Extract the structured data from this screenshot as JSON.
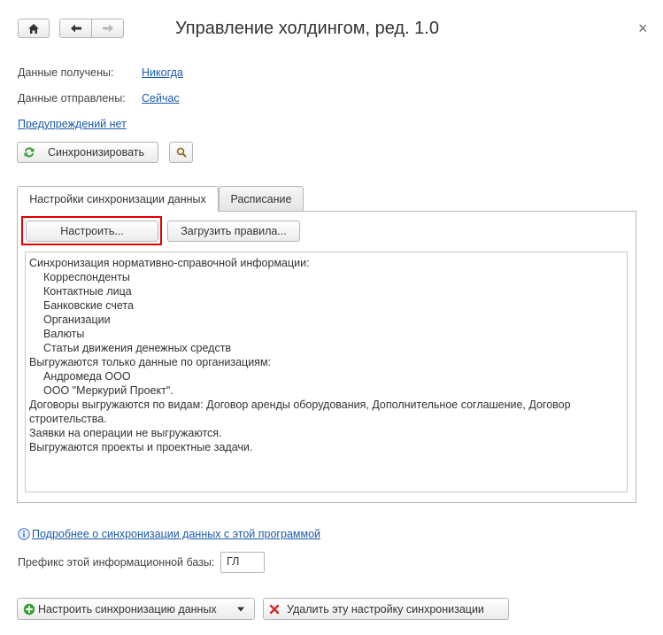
{
  "window": {
    "title": "Управление холдингом, ред. 1.0",
    "close_glyph": "×"
  },
  "status": {
    "received_label": "Данные получены:",
    "received_value": "Никогда",
    "sent_label": "Данные отправлены:",
    "sent_value": "Сейчас",
    "warnings_link": "Предупреждений нет"
  },
  "toolbar": {
    "sync_label": "Синхронизировать"
  },
  "tabs": [
    {
      "label": "Настройки синхронизации данных"
    },
    {
      "label": "Расписание"
    }
  ],
  "settings": {
    "configure_label": "Настроить...",
    "load_rules_label": "Загрузить правила..."
  },
  "description": {
    "lines": [
      {
        "text": "Синхронизация нормативно-справочной информации:",
        "indent": false
      },
      {
        "text": "Корреспонденты",
        "indent": true
      },
      {
        "text": "Контактные лица",
        "indent": true
      },
      {
        "text": "Банковские счета",
        "indent": true
      },
      {
        "text": "Организации",
        "indent": true
      },
      {
        "text": "Валюты",
        "indent": true
      },
      {
        "text": "Статьи движения денежных средств",
        "indent": true
      },
      {
        "text": "Выгружаются только данные по организациям:",
        "indent": false
      },
      {
        "text": "Андромеда ООО",
        "indent": true
      },
      {
        "text": "ООО \"Меркурий Проект\".",
        "indent": true
      },
      {
        "text": "Договоры выгружаются по видам: Договор аренды оборудования, Дополнительное соглашение, Договор строительства.",
        "indent": false
      },
      {
        "text": "Заявки на операции не выгружаются.",
        "indent": false
      },
      {
        "text": "Выгружаются проекты и проектные задачи.",
        "indent": false
      }
    ]
  },
  "footer": {
    "more_info_link": "Подробнее о синхронизации данных с этой программой",
    "prefix_label": "Префикс этой информационной базы:",
    "prefix_value": "ГЛ",
    "setup_sync_label": "Настроить синхронизацию данных",
    "delete_label": "Удалить эту настройку синхронизации"
  },
  "colors": {
    "highlight": "#e00000",
    "link": "#1a5aa8",
    "green": "#3aa033",
    "red": "#d22b2b"
  }
}
